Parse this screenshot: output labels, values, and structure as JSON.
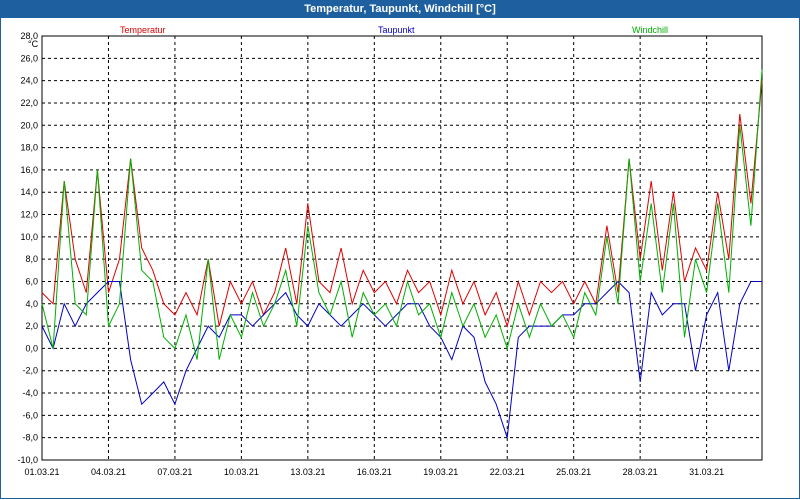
{
  "window": {
    "title": "Temperatur, Taupunkt, Windchill [°C]"
  },
  "chart_data": {
    "type": "line",
    "title": "Temperatur, Taupunkt, Windchill [°C]",
    "ylabel": "°C",
    "ylim": [
      -10,
      28
    ],
    "xlim": [
      0,
      32.5
    ],
    "grid": true,
    "legend_position": "top",
    "x_tick_labels": [
      "01.03.21",
      "04.03.21",
      "07.03.21",
      "10.03.21",
      "13.03.21",
      "16.03.21",
      "19.03.21",
      "22.03.21",
      "25.03.21",
      "28.03.21",
      "31.03.21"
    ],
    "y_tick_labels": [
      "28,0",
      "26,0",
      "24,0",
      "22,0",
      "20,0",
      "18,0",
      "16,0",
      "14,0",
      "12,0",
      "10,0",
      "8,0",
      "6,0",
      "4,0",
      "2,0",
      "0,0",
      "-2,0",
      "-4,0",
      "-6,0",
      "-8,0",
      "-10,0"
    ],
    "x": [
      0,
      0.5,
      1,
      1.5,
      2,
      2.5,
      3,
      3.5,
      4,
      4.5,
      5,
      5.5,
      6,
      6.5,
      7,
      7.5,
      8,
      8.5,
      9,
      9.5,
      10,
      10.5,
      11,
      11.5,
      12,
      12.5,
      13,
      13.5,
      14,
      14.5,
      15,
      15.5,
      16,
      16.5,
      17,
      17.5,
      18,
      18.5,
      19,
      19.5,
      20,
      20.5,
      21,
      21.5,
      22,
      22.5,
      23,
      23.5,
      24,
      24.5,
      25,
      25.5,
      26,
      26.5,
      27,
      27.5,
      28,
      28.5,
      29,
      29.5,
      30,
      30.5,
      31,
      31.5,
      32,
      32.5
    ],
    "series": [
      {
        "name": "Temperatur",
        "color": "#e00000",
        "values": [
          5,
          4,
          15,
          8,
          5,
          16,
          5,
          8,
          17,
          9,
          7,
          4,
          3,
          5,
          3,
          8,
          2,
          6,
          4,
          6,
          3,
          5,
          9,
          4,
          13,
          6,
          5,
          9,
          4,
          7,
          5,
          6,
          4,
          7,
          5,
          6,
          3,
          7,
          4,
          6,
          3,
          5,
          2,
          6,
          3,
          6,
          5,
          6,
          4,
          6,
          4,
          11,
          5,
          17,
          8,
          15,
          7,
          14,
          6,
          9,
          7,
          14,
          8,
          21,
          13,
          24,
          9,
          25,
          18
        ]
      },
      {
        "name": "Taupunkt",
        "color": "#0000c8",
        "values": [
          2,
          0,
          4,
          2,
          4,
          5,
          6,
          6,
          -1,
          -5,
          -4,
          -3,
          -5,
          -2,
          0,
          2,
          1,
          3,
          3,
          2,
          3,
          4,
          5,
          3,
          2,
          4,
          3,
          2,
          3,
          4,
          3,
          2,
          3,
          4,
          4,
          2,
          1,
          -1,
          2,
          1,
          -3,
          -5,
          -8,
          1,
          2,
          2,
          2,
          3,
          3,
          4,
          4,
          5,
          6,
          5,
          -3,
          5,
          3,
          4,
          4,
          -2,
          3,
          5,
          -2,
          4,
          6,
          6,
          7
        ]
      },
      {
        "name": "Windchill",
        "color": "#00b000",
        "values": [
          4,
          0,
          15,
          4,
          3,
          16,
          2,
          4,
          17,
          7,
          6,
          1,
          0,
          3,
          -1,
          8,
          -1,
          3,
          1,
          5,
          2,
          4,
          7,
          2,
          11,
          5,
          3,
          6,
          1,
          5,
          3,
          4,
          2,
          6,
          3,
          4,
          1,
          5,
          2,
          4,
          1,
          3,
          0,
          4,
          1,
          4,
          2,
          3,
          1,
          5,
          3,
          10,
          4,
          17,
          6,
          13,
          5,
          13,
          1,
          8,
          5,
          13,
          5,
          20,
          11,
          25,
          7,
          27,
          18
        ]
      }
    ]
  }
}
